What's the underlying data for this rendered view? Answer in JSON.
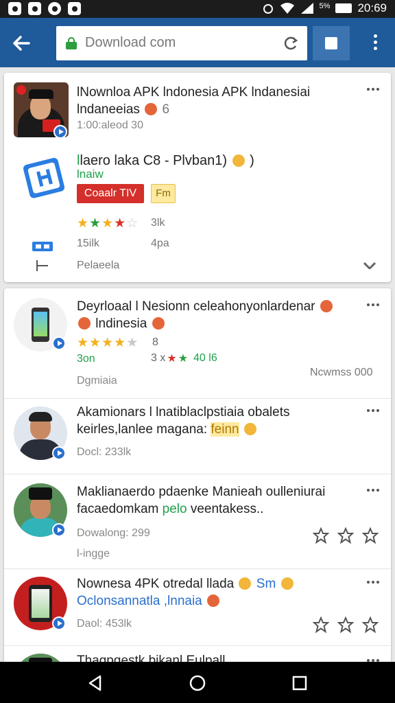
{
  "status_bar": {
    "battery_text": "5%",
    "time": "20:69"
  },
  "toolbar": {
    "url": "Download com"
  },
  "card1": {
    "title": "lNownloa APK lndonesia APK lndanesiai",
    "title_line2": "lndaneeias",
    "title_suffix": "6",
    "meta": "1:00:aleod  30",
    "app_title": "laero laka C8 - Plvban1)",
    "app_title_suffix": ")",
    "app_sub": "lnaiw",
    "chip_red": "Coaalr TIV",
    "chip_yellow": "Fm",
    "rating_text": "3lk",
    "stat_left": "15ilk",
    "stat_right": "4pa",
    "footer": "Pelaeela"
  },
  "list": [
    {
      "title_line1": "Deyrloaal l Nesionn celeahonyonlardenar",
      "title_line2": "lndinesia",
      "rating_count": "8",
      "green_left": "3on",
      "green_right": "40 l6",
      "pre_stars": "3 x",
      "sub": "Dgmiaia",
      "right_meta": "Ncwmss 000"
    },
    {
      "title_line1": "Akamionars l lnatiblaclpstiaia obalets",
      "title_line2": "keirles,lanlee magana:",
      "title_highlight": "feinn",
      "sub": "Docl: 233lk"
    },
    {
      "title_line1": "Maklianaerdo pdaenke Manieah oulleniurai",
      "title_line2_a": "facaedomkam",
      "title_line2_b": "pelo",
      "title_line2_c": "veentakess..",
      "downloads": "Dowalong: 299",
      "sub": "l-ingge"
    },
    {
      "title_line1": "Nownesa 4PK otredal llada",
      "title_line1_suffix": "Sm",
      "title_line2": "Oclonsannatla ,lnnaia",
      "sub": "Daol: 453lk"
    },
    {
      "title_line1": "Thagpgestk bikanl Eulpall"
    }
  ],
  "colors": {
    "toolbar": "#1f5a9a",
    "accent_green": "#1ea14a",
    "chip_red": "#d42f2a",
    "star": "#f2b01e"
  }
}
